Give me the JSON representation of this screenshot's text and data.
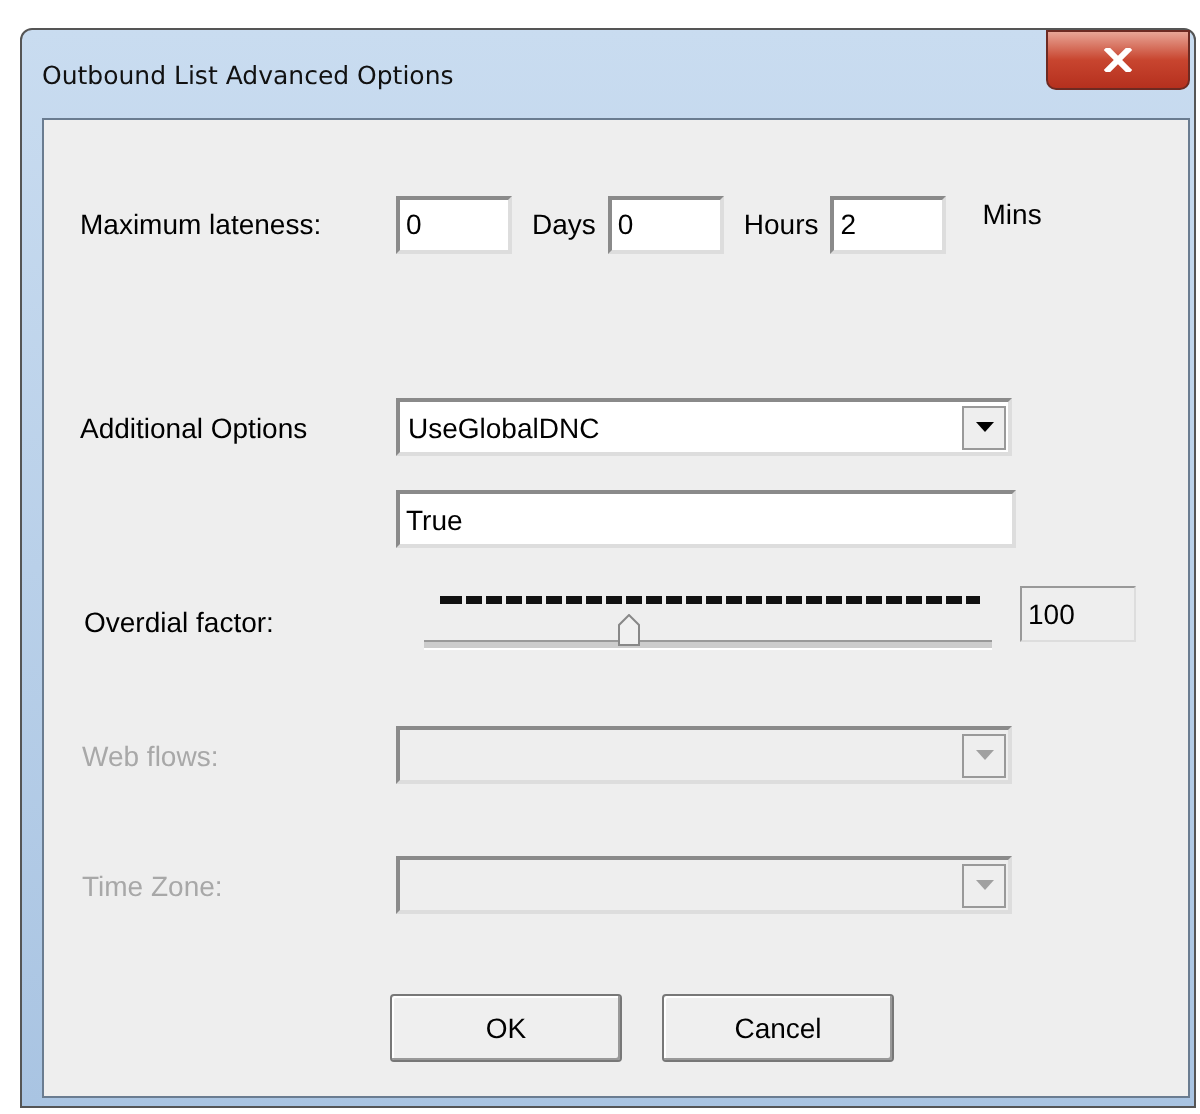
{
  "window": {
    "title": "Outbound List Advanced Options"
  },
  "lateness": {
    "label": "Maximum lateness:",
    "fields": [
      {
        "value": "0",
        "unit": "Days"
      },
      {
        "value": "0",
        "unit": "Hours"
      },
      {
        "value": "2",
        "unit": "Mins"
      }
    ]
  },
  "additional_options": {
    "label": "Additional Options",
    "selected_option": "UseGlobalDNC",
    "value": "True"
  },
  "overdial": {
    "label": "Overdial factor:",
    "level": 0.36,
    "reading": "100"
  },
  "dropdowns": [
    {
      "label": "Web flows:",
      "disabled": true
    },
    {
      "label": "Time Zone:",
      "disabled": true
    }
  ],
  "buttons": [
    "OK",
    "Cancel"
  ]
}
